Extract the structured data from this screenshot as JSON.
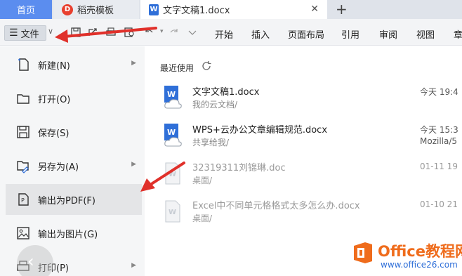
{
  "tabs": {
    "home": "首页",
    "templates": "稻壳模板",
    "document": "文字文稿1.docx",
    "close_icon": "close-icon",
    "new_tab_icon": "plus-icon"
  },
  "toolbar": {
    "file_label": "文件",
    "menu_tabs": [
      "开始",
      "插入",
      "页面布局",
      "引用",
      "审阅",
      "视图",
      "章"
    ]
  },
  "left_menu": {
    "items": [
      {
        "label": "新建(N)",
        "icon": "new-doc-icon",
        "submenu": true
      },
      {
        "label": "打开(O)",
        "icon": "folder-icon",
        "submenu": false
      },
      {
        "label": "保存(S)",
        "icon": "save-icon",
        "submenu": false
      },
      {
        "label": "另存为(A)",
        "icon": "save-as-icon",
        "submenu": true
      },
      {
        "label": "输出为PDF(F)",
        "icon": "pdf-export-icon",
        "submenu": false
      },
      {
        "label": "输出为图片(G)",
        "icon": "image-export-icon",
        "submenu": false
      },
      {
        "label": "打印(P)",
        "icon": "print-icon",
        "submenu": true
      }
    ],
    "active_index": 4
  },
  "recent": {
    "title": "最近使用",
    "files": [
      {
        "name": "文字文稿1.docx",
        "location": "我的云文档/",
        "date": "今天 19:4",
        "extra": "",
        "cloud": true
      },
      {
        "name": "WPS+云办公文章编辑规范.docx",
        "location": "共享给我/",
        "date": "今天 15:3",
        "extra": "Mozilla/5",
        "cloud": true
      },
      {
        "name": "32319311刘锦琳.doc",
        "location": "桌面/",
        "date": "01-11 19",
        "extra": "",
        "cloud": false
      },
      {
        "name": "Excel中不同单元格格式太多怎么办.docx",
        "location": "桌面/",
        "date": "01-10 21",
        "extra": "",
        "cloud": false
      }
    ]
  },
  "watermark": {
    "name": "Office教程网",
    "url": "www.office26.com"
  },
  "colors": {
    "accent": "#5b8def",
    "annotation_arrow": "#e0302a",
    "word_blue": "#2f6fd8",
    "watermark_orange": "#ef6c1c"
  }
}
